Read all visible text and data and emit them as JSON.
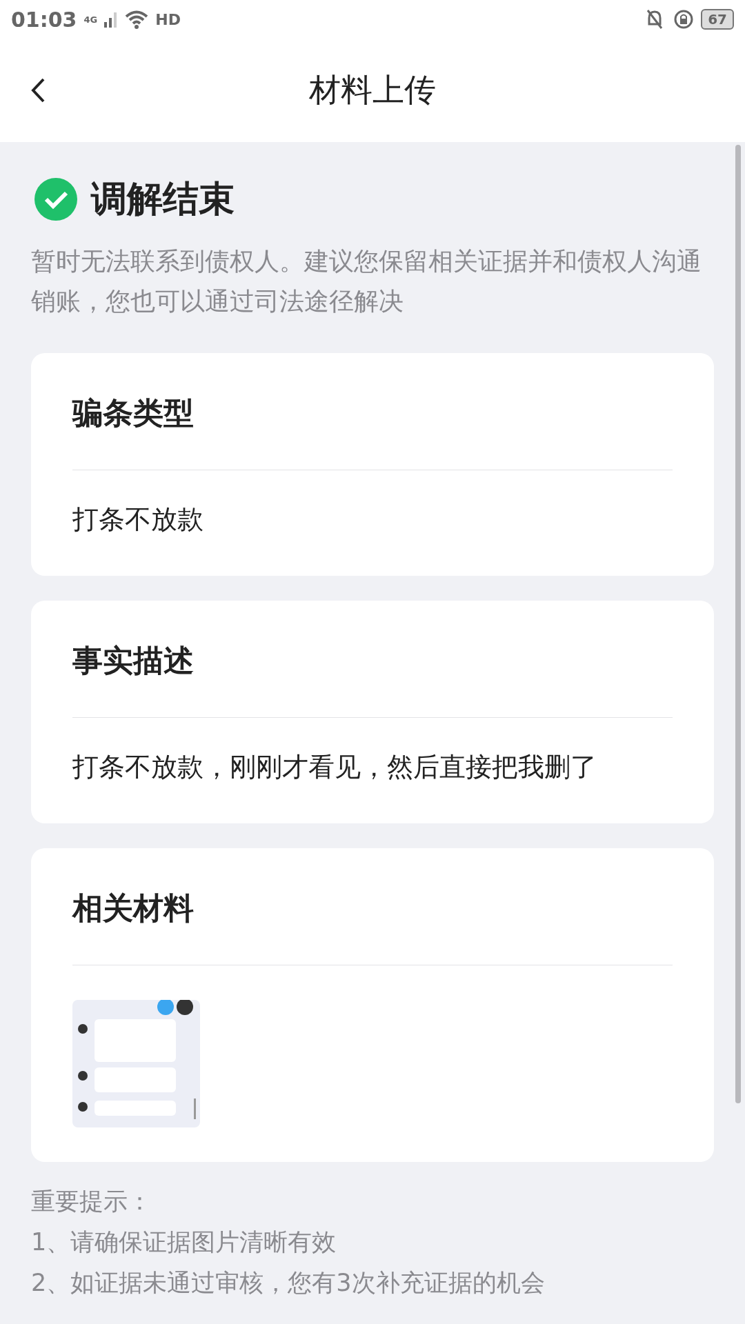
{
  "status_bar": {
    "time": "01:03",
    "network": "4G",
    "call_badge": "HD",
    "battery": "67"
  },
  "header": {
    "title": "材料上传"
  },
  "result": {
    "done": true,
    "title": "调解结束",
    "description": "暂时无法联系到债权人。建议您保留相关证据并和债权人沟通销账，您也可以通过司法途径解决"
  },
  "cards": [
    {
      "kind": "text",
      "title": "骗条类型",
      "value": "打条不放款"
    },
    {
      "kind": "text",
      "title": "事实描述",
      "value": "打条不放款，刚刚才看见，然后直接把我删了"
    },
    {
      "kind": "images",
      "title": "相关材料"
    }
  ],
  "notice": {
    "title": "重要提示：",
    "items": [
      "1、请确保证据图片清晰有效",
      "2、如证据未通过审核，您有3次补充证据的机会"
    ]
  }
}
